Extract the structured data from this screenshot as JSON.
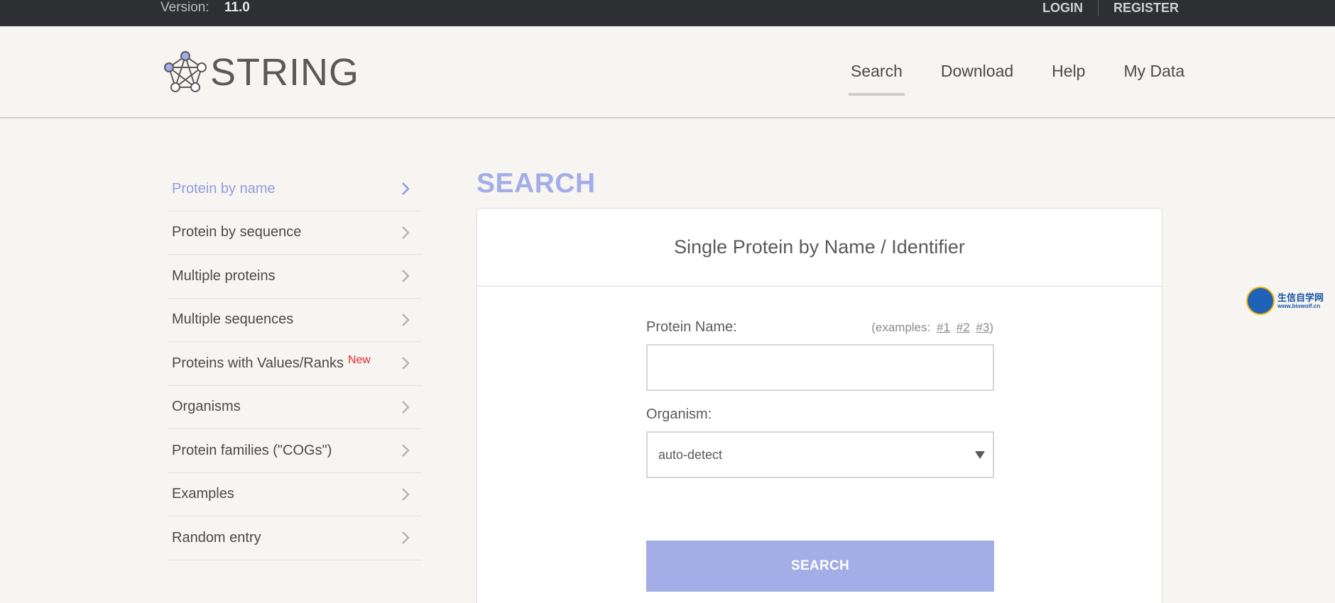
{
  "topbar": {
    "version_label": "Version:",
    "version_number": "11.0",
    "login": "LOGIN",
    "register": "REGISTER"
  },
  "header": {
    "logo_text": "STRING",
    "nav": [
      {
        "label": "Search",
        "active": true
      },
      {
        "label": "Download"
      },
      {
        "label": "Help"
      },
      {
        "label": "My Data"
      }
    ]
  },
  "sidebar": {
    "items": [
      {
        "label": "Protein by name",
        "active": true
      },
      {
        "label": "Protein by sequence"
      },
      {
        "label": "Multiple proteins"
      },
      {
        "label": "Multiple sequences"
      },
      {
        "label": "Proteins with Values/Ranks",
        "badge": "New"
      },
      {
        "label": "Organisms"
      },
      {
        "label": "Protein families (\"COGs\")"
      },
      {
        "label": "Examples"
      },
      {
        "label": "Random entry"
      }
    ]
  },
  "main": {
    "title": "SEARCH",
    "card_title": "Single Protein by Name / Identifier",
    "protein_label": "Protein Name:",
    "examples_prefix": "(examples:",
    "example_links": [
      "#1",
      "#2",
      "#3"
    ],
    "examples_suffix": ")",
    "protein_value": "",
    "organism_label": "Organism:",
    "organism_selected": "auto-detect",
    "search_button": "SEARCH"
  },
  "watermark": {
    "main": "生信自学网",
    "sub": "www.biowolf.cn"
  },
  "colors": {
    "accent": "#a3ade6",
    "active_link": "#8f9de0",
    "topbar_bg": "#2d2f33",
    "badge": "#e12727"
  }
}
